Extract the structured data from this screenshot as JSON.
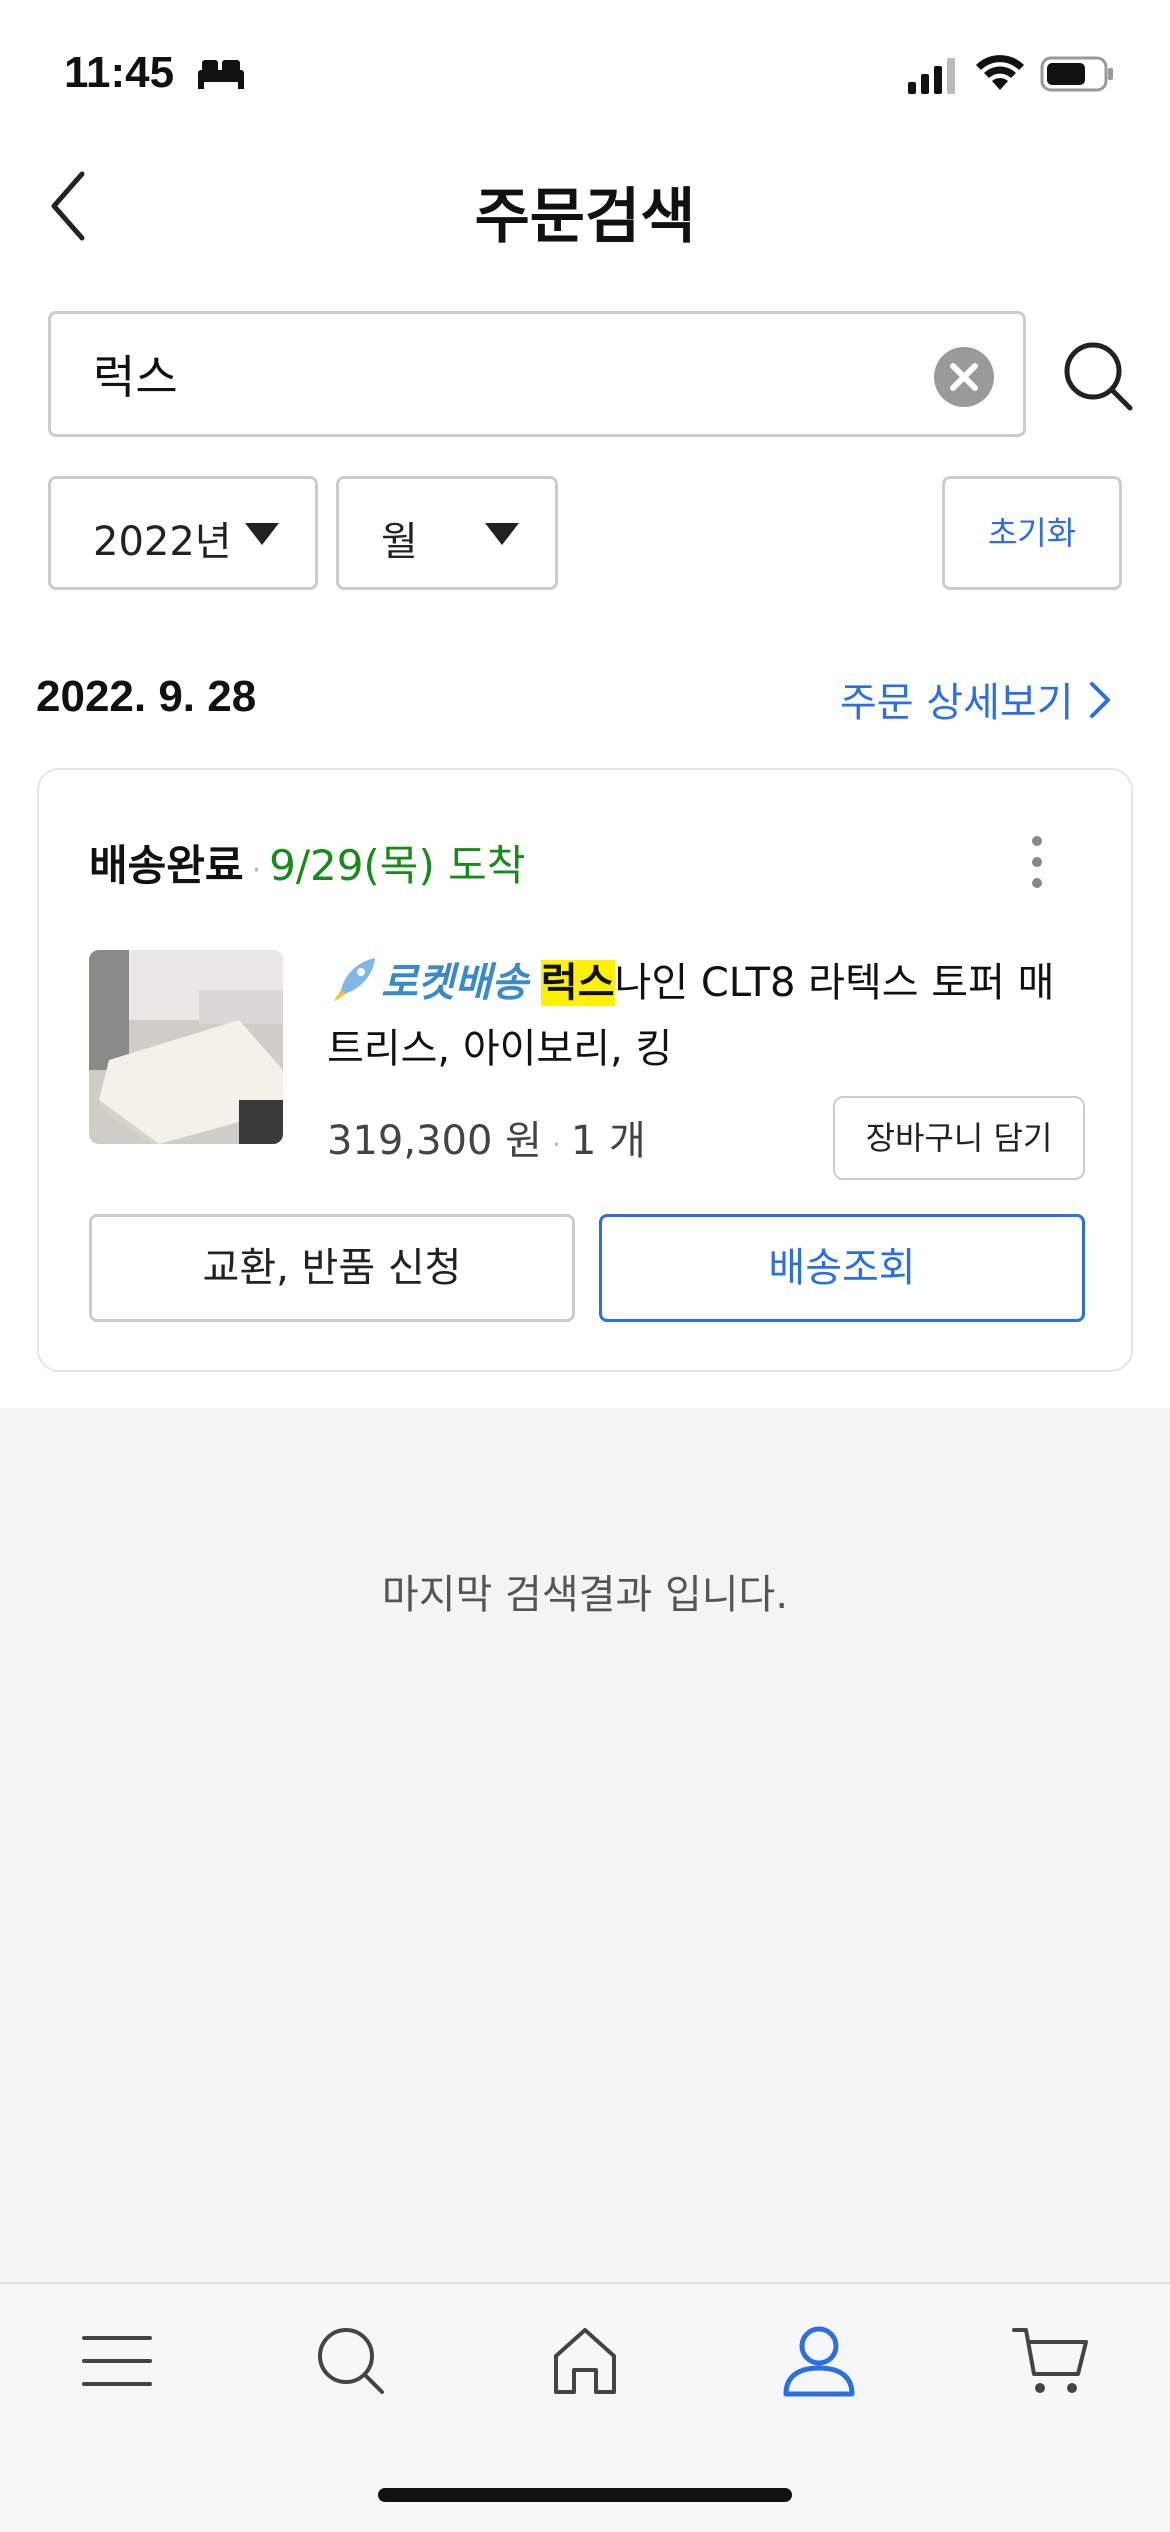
{
  "status_bar": {
    "time": "11:45",
    "icons": [
      "bed-icon",
      "signal-icon",
      "wifi-icon",
      "battery-icon"
    ]
  },
  "header": {
    "title": "주문검색",
    "back_icon": "chevron-left-icon"
  },
  "search": {
    "value": "럭스",
    "placeholder": "",
    "clear_icon": "clear-icon",
    "search_icon": "search-icon"
  },
  "filters": {
    "year": "2022년",
    "month": "월",
    "reset_label": "초기화"
  },
  "order": {
    "date": "2022. 9. 28",
    "detail_link": "주문 상세보기",
    "status": "배송완료",
    "separator": "·",
    "arrival": "9/29(목) 도착",
    "product": {
      "rocket_label": "로켓배송",
      "highlight": "럭스",
      "title_rest": "나인 CLT8 라텍스 토퍼 매트리스, 아이보리, 킹",
      "price": "319,300 원",
      "quantity": "1 개",
      "cart_button": "장바구니 담기"
    },
    "return_button": "교환, 반품 신청",
    "tracking_button": "배송조회"
  },
  "end_message": "마지막 검색결과 입니다.",
  "bottom_nav": {
    "items": [
      "menu-icon",
      "search-icon",
      "home-icon",
      "user-icon",
      "cart-icon"
    ],
    "active": "user-icon"
  },
  "colors": {
    "accent_blue": "#2b6fe0",
    "arrival_green": "#178a17",
    "highlight_yellow": "#fff200",
    "rocket_blue": "#3a8ac9"
  }
}
